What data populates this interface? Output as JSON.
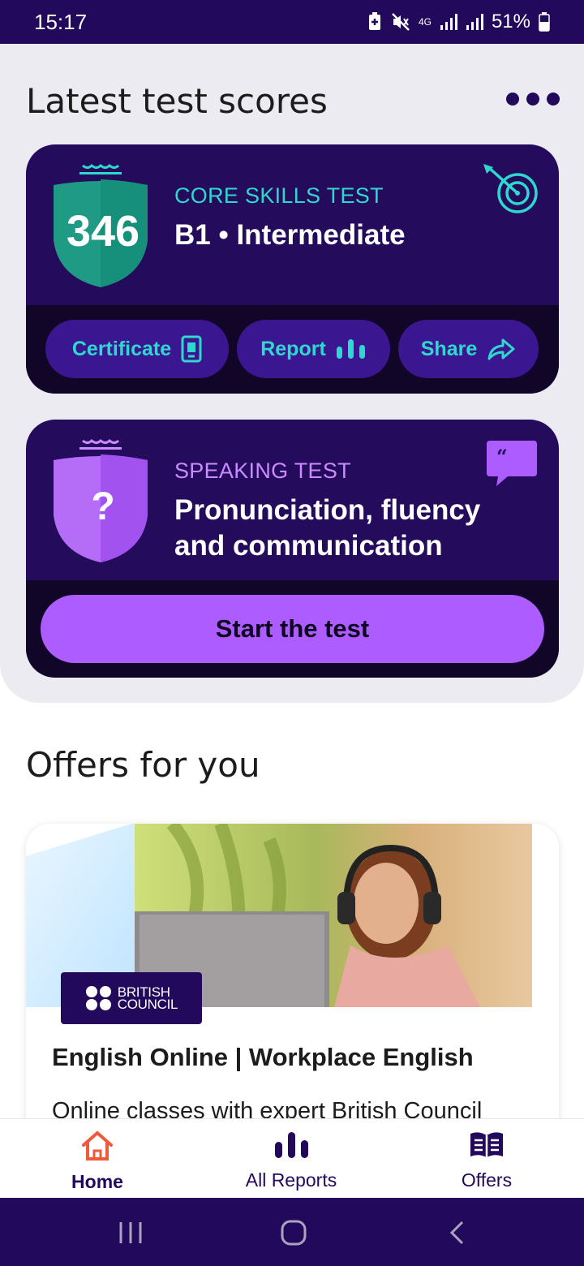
{
  "status_bar": {
    "time": "15:17",
    "network": "4G",
    "battery": "51%"
  },
  "scores_section": {
    "title": "Latest test scores",
    "more_icon": "more-horizontal-icon"
  },
  "core_test": {
    "score": "346",
    "kicker": "CORE SKILLS TEST",
    "level": "B1 • Intermediate",
    "kicker_color": "#2fd8cf",
    "actions": {
      "certificate": "Certificate",
      "report": "Report",
      "share": "Share"
    }
  },
  "speaking_test": {
    "kicker": "SPEAKING TEST",
    "heading_line1": "Pronunciation, fluency",
    "heading_line2": "and communication",
    "shield_symbol": "?",
    "kicker_color": "#c98bff",
    "start_label": "Start the test"
  },
  "offers_section": {
    "title": "Offers for you"
  },
  "offer": {
    "logo_line1": "BRITISH",
    "logo_line2": "COUNCIL",
    "title": "English Online | Workplace English",
    "description": "Online classes with expert British Council"
  },
  "bottom_nav": {
    "home": "Home",
    "reports": "All Reports",
    "offers": "Offers"
  },
  "colors": {
    "brand": "#23095c",
    "accent_teal": "#2fd8cf",
    "accent_purple": "#ad5cff",
    "home_active": "#ef5a3c"
  }
}
